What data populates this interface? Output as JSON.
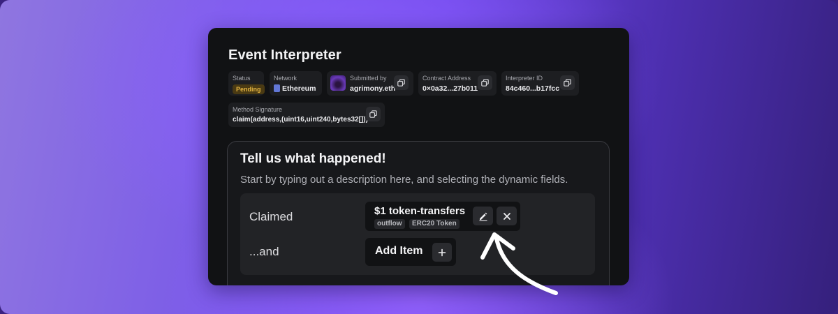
{
  "app": {
    "title": "Event Interpreter"
  },
  "meta": {
    "status": {
      "label": "Status",
      "value": "Pending"
    },
    "network": {
      "label": "Network",
      "value": "Ethereum",
      "icon": "ethereum-icon"
    },
    "submitted_by": {
      "label": "Submitted by",
      "value": "agrimony.eth"
    },
    "contract": {
      "label": "Contract Address",
      "value": "0×0a32...27b011"
    },
    "interpreter": {
      "label": "Interpreter ID",
      "value": "84c460...b17fcc"
    },
    "method": {
      "label": "Method Signature",
      "value": "claim(address,(uint16,uint240,bytes32[]))"
    }
  },
  "panel": {
    "heading": "Tell us what happened!",
    "subtitle": "Start by typing out a description here, and selecting the dynamic fields.",
    "rows": [
      {
        "label": "Claimed",
        "token": {
          "name": "$1 token-transfers",
          "tags": [
            "outflow",
            "ERC20 Token"
          ]
        }
      },
      {
        "label": "...and",
        "action": "Add Item"
      }
    ]
  },
  "colors": {
    "accent_purple": "#7b52f0",
    "card_bg": "#111214",
    "pending_text": "#e2b340",
    "pending_bg": "#4a3a13"
  },
  "icons": [
    "copy-icon",
    "pencil-icon",
    "close-icon",
    "plus-icon",
    "curved-arrow-annotation"
  ]
}
